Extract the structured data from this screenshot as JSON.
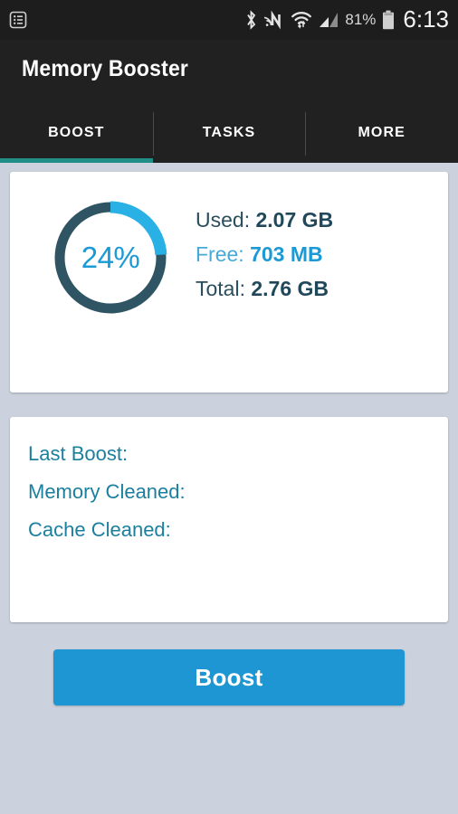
{
  "statusbar": {
    "left_icons": [
      {
        "name": "notification-list-icon",
        "glyph": "list-box"
      }
    ],
    "right_icons": [
      {
        "name": "bluetooth-icon"
      },
      {
        "name": "nfc-icon"
      },
      {
        "name": "wifi-icon"
      },
      {
        "name": "cellular-signal-icon"
      },
      {
        "name": "battery-icon"
      }
    ],
    "battery_percent": "81%",
    "clock": "6:13"
  },
  "appbar": {
    "title": "Memory Booster"
  },
  "tabs": [
    {
      "label": "BOOST",
      "active": true
    },
    {
      "label": "TASKS",
      "active": false
    },
    {
      "label": "MORE",
      "active": false
    }
  ],
  "memory_card": {
    "percent_label": "24%",
    "percent_value": 24,
    "lines": [
      {
        "label": "Used:",
        "value": "2.07 GB",
        "highlight": false
      },
      {
        "label": "Free:",
        "value": "703 MB",
        "highlight": true
      },
      {
        "label": "Total:",
        "value": "2.76 GB",
        "highlight": false
      }
    ]
  },
  "stats_card": {
    "lines": [
      {
        "label": "Last Boost:",
        "value": ""
      },
      {
        "label": "Memory Cleaned:",
        "value": ""
      },
      {
        "label": "Cache Cleaned:",
        "value": ""
      }
    ]
  },
  "boost_button": {
    "label": "Boost"
  },
  "colors": {
    "background": "#ccd2dd",
    "appbar": "#212121",
    "statusbar": "#1d1d1d",
    "accent_blue": "#1d96d3",
    "donut_track": "#2f5464",
    "donut_progress": "#29b1e6",
    "tab_indicator": "#1f8e86",
    "stat_text": "#1b7f9e"
  }
}
